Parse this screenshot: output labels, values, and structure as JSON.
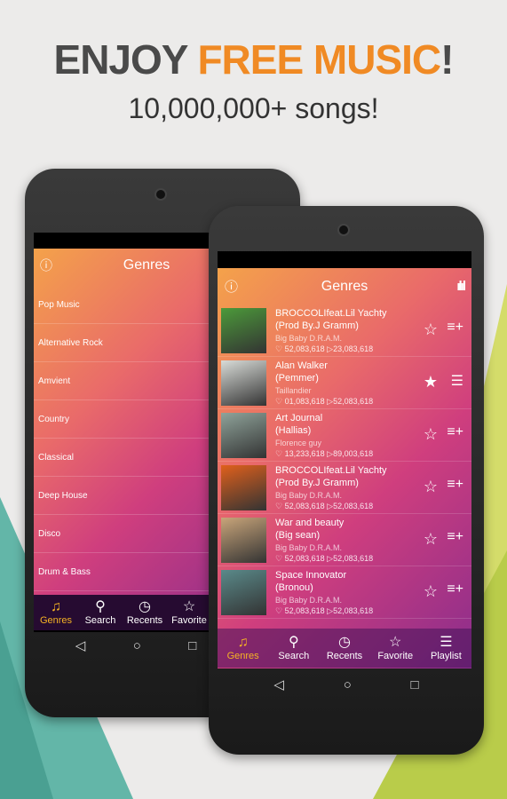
{
  "headline": {
    "part1": "ENJOY ",
    "part2": "FREE MUSIC",
    "part3": "!"
  },
  "subheadline": "10,000,000+ songs!",
  "colors": {
    "accent": "#f08a24",
    "active_tab": "#f5b324"
  },
  "back_phone": {
    "header_title": "Genres",
    "genres": [
      "Pop Music",
      "Alternative Rock",
      "Amvient",
      "Country",
      "Classical",
      "Deep House",
      "Disco",
      "Drum & Bass"
    ],
    "nav": [
      {
        "label": "Genres",
        "icon": "music-note-icon"
      },
      {
        "label": "Search",
        "icon": "search-icon"
      },
      {
        "label": "Recents",
        "icon": "clock-icon"
      },
      {
        "label": "Favorite",
        "icon": "star-icon"
      }
    ]
  },
  "front_phone": {
    "header_title": "Genres",
    "songs": [
      {
        "title": "BROCCOLIfeat.Lil Yachty",
        "subtitle": "(Prod By.J Gramm)",
        "artist": "Big Baby D.R.A.M.",
        "likes": "52,083,618",
        "plays": "23,083,618",
        "favorited": false,
        "thumb": "#4c9a3a"
      },
      {
        "title": "Alan Walker",
        "subtitle": "(Pemmer)",
        "artist": "Taillandier",
        "likes": "01,083,618",
        "plays": "52,083,618",
        "favorited": true,
        "thumb": "#d9dcd8"
      },
      {
        "title": "Art Journal",
        "subtitle": "(Hallias)",
        "artist": "Florence guy",
        "likes": "13,233,618",
        "plays": "89,003,618",
        "favorited": false,
        "thumb": "#8fa39a"
      },
      {
        "title": "BROCCOLIfeat.Lil Yachty",
        "subtitle": "(Prod By.J Gramm)",
        "artist": "Big Baby D.R.A.M.",
        "likes": "52,083,618",
        "plays": "52,083,618",
        "favorited": false,
        "thumb": "#e0601c"
      },
      {
        "title": "War and beauty",
        "subtitle": "(Big sean)",
        "artist": "Big Baby D.R.A.M.",
        "likes": "52,083,618",
        "plays": "52,083,618",
        "favorited": false,
        "thumb": "#c9a57a"
      },
      {
        "title": "Space Innovator",
        "subtitle": "(Bronou)",
        "artist": "Big Baby D.R.A.M.",
        "likes": "52,083,618",
        "plays": "52,083,618",
        "favorited": false,
        "thumb": "#5a8a8a"
      }
    ],
    "nav": [
      {
        "label": "Genres",
        "icon": "music-note-icon"
      },
      {
        "label": "Search",
        "icon": "search-icon"
      },
      {
        "label": "Recents",
        "icon": "clock-icon"
      },
      {
        "label": "Favorite",
        "icon": "star-icon"
      },
      {
        "label": "Playlist",
        "icon": "playlist-icon"
      }
    ]
  }
}
